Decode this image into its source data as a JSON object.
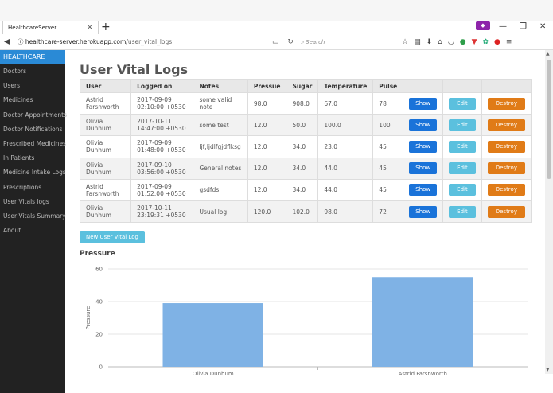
{
  "browser": {
    "tab_title": "HealthcareServer",
    "close_glyph": "×",
    "newtab_glyph": "+",
    "url_host": "healthcare-server.herokuapp.com",
    "url_path": "/user_vital_logs",
    "search_placeholder": "Search"
  },
  "sidebar": {
    "brand": "HEALTHCARE",
    "items": [
      "Doctors",
      "Users",
      "Medicines",
      "Doctor Appointments",
      "Doctor Notifications",
      "Prescribed Medicines",
      "In Patients",
      "Medicine Intake Logs",
      "Prescriptions",
      "User Vitals logs",
      "User Vitals Summary",
      "About"
    ]
  },
  "page": {
    "title": "User Vital Logs",
    "new_button": "New User Vital Log",
    "chart_heading": "Pressure"
  },
  "table": {
    "headers": [
      "User",
      "Logged on",
      "Notes",
      "Pressue",
      "Sugar",
      "Temperature",
      "Pulse"
    ],
    "actions": {
      "show": "Show",
      "edit": "Edit",
      "destroy": "Destroy"
    },
    "rows": [
      [
        "Astrid Farsnworth",
        "2017-09-09 02:10:00 +0530",
        "some valid note",
        "98.0",
        "908.0",
        "67.0",
        "78"
      ],
      [
        "Olivia Dunhum",
        "2017-10-11 14:47:00 +0530",
        "some test",
        "12.0",
        "50.0",
        "100.0",
        "100"
      ],
      [
        "Olivia Dunhum",
        "2017-09-09 01:48:00 +0530",
        "ljf;ljdlfgjdflksg",
        "12.0",
        "34.0",
        "23.0",
        "45"
      ],
      [
        "Olivia Dunhum",
        "2017-09-10 03:56:00 +0530",
        "General notes",
        "12.0",
        "34.0",
        "44.0",
        "45"
      ],
      [
        "Astrid Farsnworth",
        "2017-09-09 01:52:00 +0530",
        "gsdfds",
        "12.0",
        "34.0",
        "44.0",
        "45"
      ],
      [
        "Olivia Dunhum",
        "2017-10-11 23:19:31 +0530",
        "Usual log",
        "120.0",
        "102.0",
        "98.0",
        "72"
      ]
    ]
  },
  "chart_data": {
    "type": "bar",
    "categories": [
      "Olivia Dunhum",
      "Astrid Farsnworth"
    ],
    "values": [
      39,
      55
    ],
    "ylabel": "Pressure",
    "yticks": [
      0,
      20,
      40,
      60
    ],
    "ylim": [
      0,
      60
    ],
    "color": "#7fb2e5"
  },
  "colors": {
    "brand": "#2a8ad6",
    "show": "#1a73d9",
    "edit": "#5bc0de",
    "destroy": "#e07b17"
  }
}
